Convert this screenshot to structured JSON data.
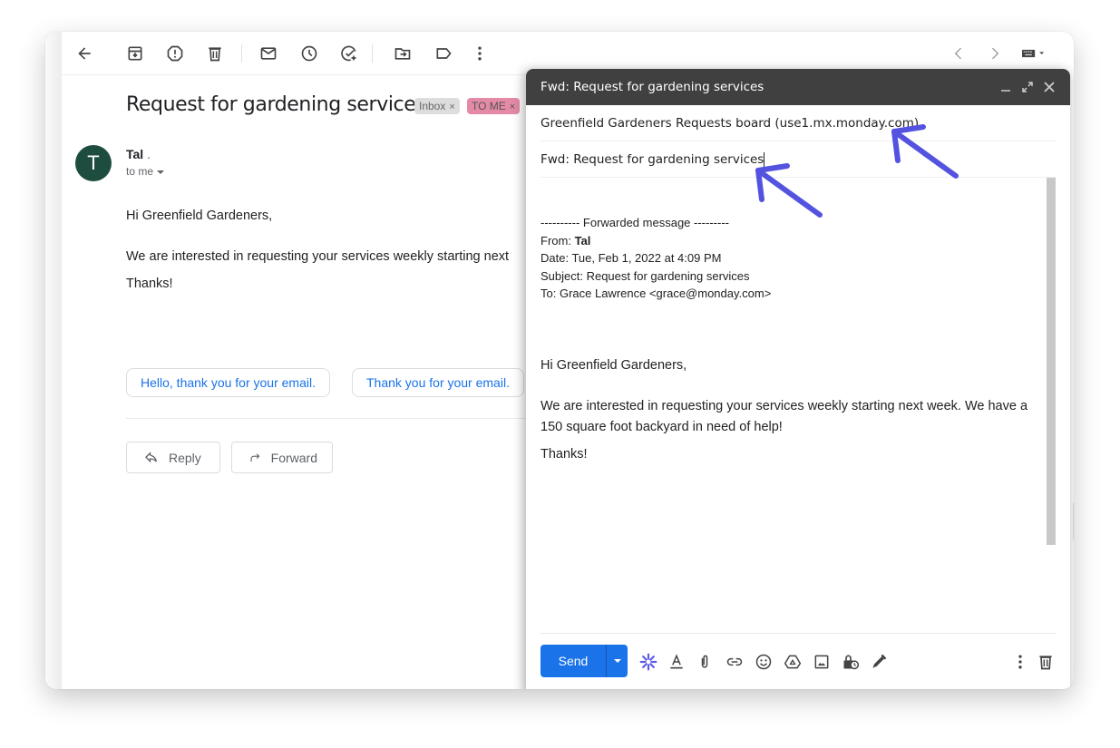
{
  "toolbar": {
    "icons": [
      "back-arrow-icon",
      "archive-icon",
      "report-spam-icon",
      "delete-icon",
      "mark-unread-icon",
      "snooze-icon",
      "add-task-icon",
      "move-to-icon",
      "label-icon",
      "more-vert-icon"
    ],
    "nav": [
      "newer-chevron-icon",
      "older-chevron-icon",
      "keyboard-icon"
    ]
  },
  "email": {
    "subject": "Request for gardening services",
    "labels": [
      {
        "name": "Inbox",
        "color": "#dddddd"
      },
      {
        "name": "TO ME",
        "color": "#e48aa6"
      }
    ],
    "label_remove": "×",
    "avatar_letter": "T",
    "avatar_color": "#1e4d3f",
    "sender_name": "Tal",
    "sender_suffix": " .",
    "recipient": "to me",
    "body": {
      "greeting": "Hi Greenfield Gardeners,",
      "paragraph": "We are interested in requesting your services weekly starting next",
      "closing": "Thanks!"
    },
    "smart_replies": [
      "Hello, thank you for your email.",
      "Thank you for your email."
    ],
    "reply_label": "Reply",
    "forward_label": "Forward"
  },
  "compose": {
    "window_title": "Fwd: Request for gardening services",
    "to_value": "Greenfield Gardeners Requests board (use1.mx.monday.com)",
    "subject_value": "Fwd: Request for gardening services",
    "forwarded": {
      "header": "---------- Forwarded message ---------",
      "from_label": "From: ",
      "from_name": "Tal",
      "date": "Date: Tue, Feb 1, 2022 at 4:09 PM",
      "subject": "Subject: Request for gardening services",
      "to": "To: Grace Lawrence <grace@monday.com>"
    },
    "body": {
      "greeting": "Hi Greenfield Gardeners,",
      "paragraph": "We are interested in requesting your services weekly starting next week. We have a 150 square foot backyard in need of help!",
      "closing": "Thanks!"
    },
    "send_label": "Send",
    "send_color": "#1a73e8",
    "footer_icons": [
      "monday-integration-icon",
      "formatting-icon",
      "attach-icon",
      "link-icon",
      "emoji-icon",
      "drive-icon",
      "photo-icon",
      "confidential-icon",
      "signature-icon",
      "more-options-icon",
      "discard-icon"
    ]
  },
  "annotation": {
    "arrow_color": "#5353e0"
  }
}
